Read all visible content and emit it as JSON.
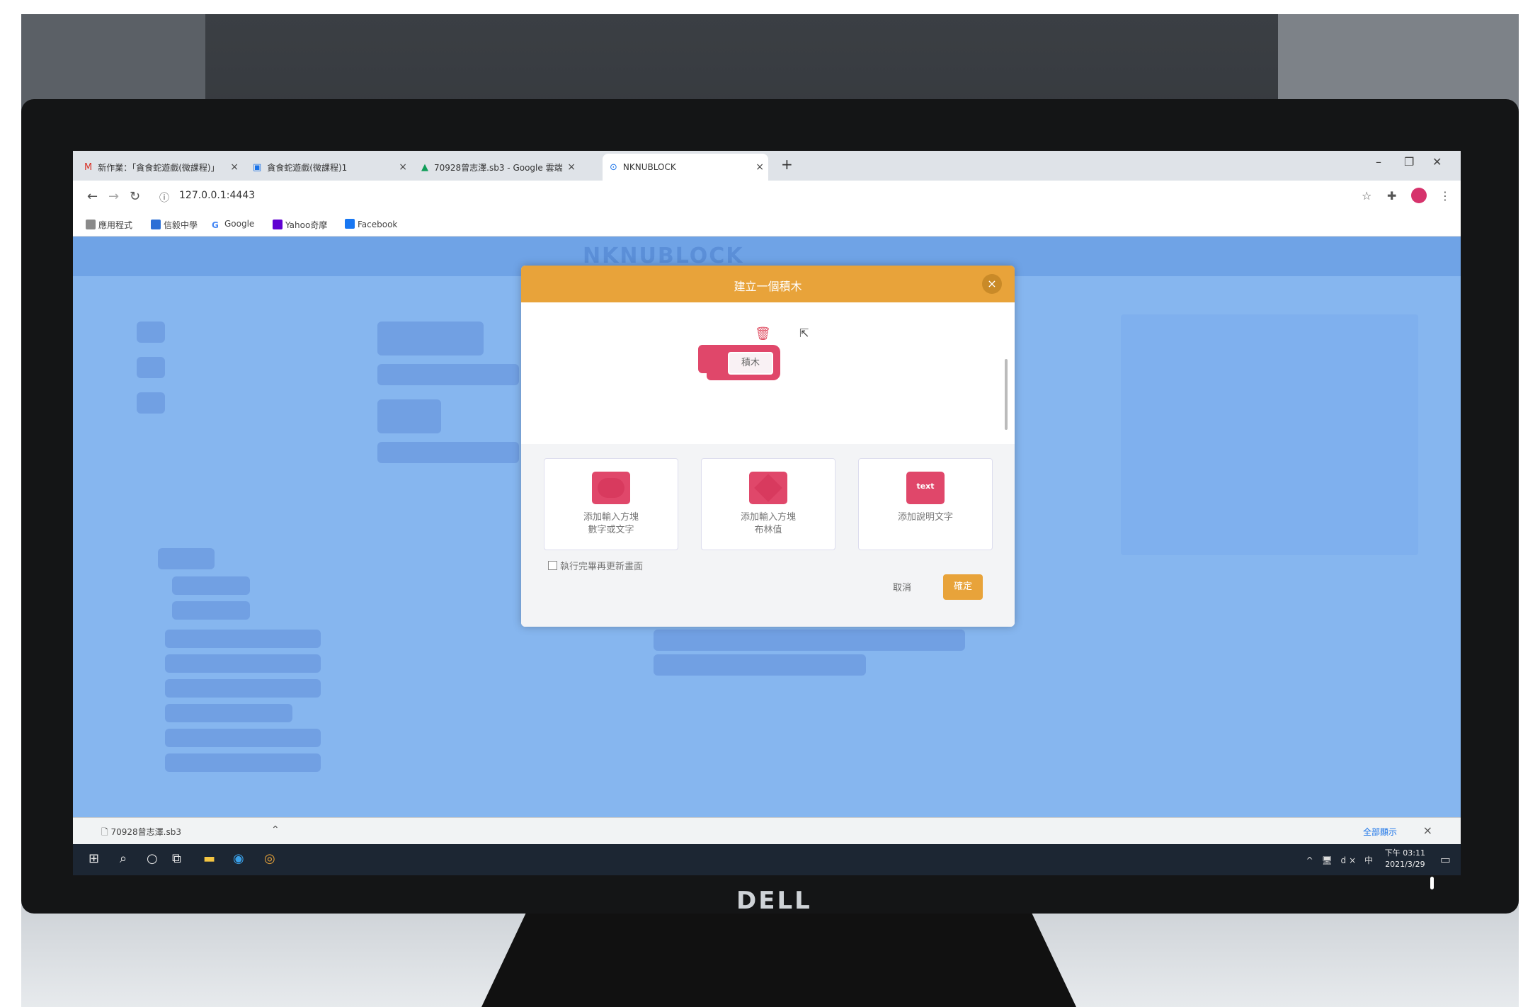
{
  "browser": {
    "tabs": [
      {
        "icon": "M",
        "label": "新作業：「貪食蛇遊戲(微課程)」",
        "close": "×"
      },
      {
        "icon": "▣",
        "label": "貪食蛇遊戲(微課程)1",
        "close": "×"
      },
      {
        "icon": "▲",
        "label": "70928曾志澤.sb3 - Google 雲端",
        "close": "×"
      },
      {
        "icon": "⊙",
        "label": "NKNUBLOCK",
        "close": "×"
      }
    ],
    "new_tab": "+",
    "window_controls": [
      "–",
      "❐",
      "✕"
    ],
    "url": "127.0.0.1:4443",
    "bookmarks": [
      {
        "label": "應用程式",
        "color": "#8a8a8a"
      },
      {
        "label": "信毅中學",
        "color": "#2b6fd6"
      },
      {
        "label": "Google",
        "color": "#ffffff"
      },
      {
        "label": "Yahoo奇摩",
        "color": "#6001d2"
      },
      {
        "label": "Facebook",
        "color": "#1877f2"
      }
    ]
  },
  "app": {
    "logo": "NKNUBLOCK"
  },
  "dialog": {
    "title": "建立一個積木",
    "close": "×",
    "block_label": "積木",
    "options": [
      {
        "line1": "添加輸入方塊",
        "line2": "數字或文字",
        "shape": "oval"
      },
      {
        "line1": "添加輸入方塊",
        "line2": "布林值",
        "shape": "diamond"
      },
      {
        "line1": "添加說明文字",
        "line2": "",
        "shape": "text",
        "icon_text": "text"
      }
    ],
    "checkbox_label": "執行完畢再更新畫面",
    "checkbox_checked": false,
    "cancel": "取消",
    "ok": "確定",
    "accent": "#e8a33a",
    "block_color": "#e0476a"
  },
  "download_bar": {
    "file": "70928曾志澤.sb3",
    "show_all": "全部顯示",
    "close": "×"
  },
  "taskbar": {
    "time": "下午 03:11",
    "date": "2021/3/29",
    "tray": "^ 🖥 d× 中"
  },
  "monitor": {
    "brand": "DELL"
  }
}
